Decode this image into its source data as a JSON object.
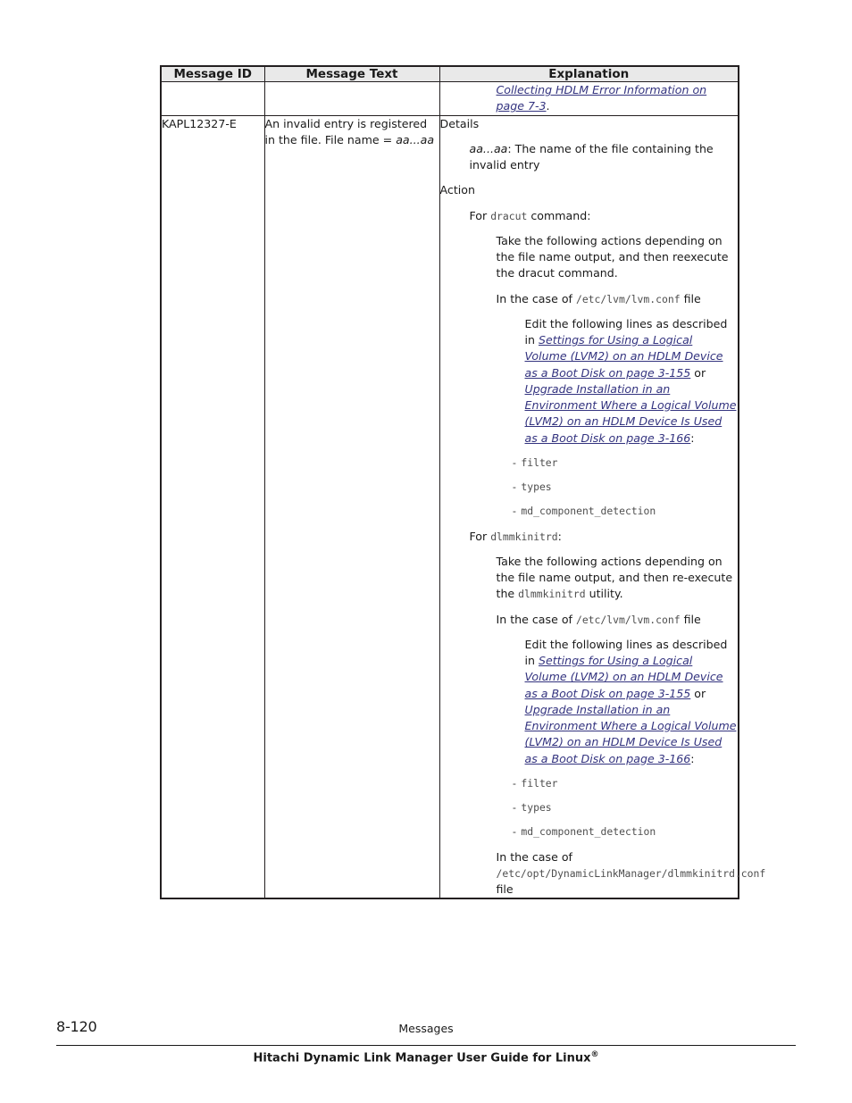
{
  "document": {
    "page_number": "8-120",
    "footer_section": "Messages",
    "footer_title_main": "Hitachi Dynamic Link Manager User Guide for Linux",
    "footer_title_sup": "®"
  },
  "table": {
    "headers": {
      "message_id": "Message ID",
      "message_text": "Message Text",
      "explanation": "Explanation"
    },
    "rows": [
      {
        "message_id": "",
        "message_text": "",
        "explanation_continued_link": "Collecting HDLM Error Information on page 7-3",
        "explanation_continued_tail": "."
      },
      {
        "message_id": "KAPL12327-E",
        "message_text_part1": "An invalid entry is registered in the file. File name = ",
        "message_text_var": "aa...aa",
        "details_label": "Details",
        "details_var": "aa...aa",
        "details_desc": ": The name of the file containing the invalid entry",
        "action_label": "Action",
        "dracut": {
          "for_prefix": "For ",
          "command": "dracut",
          "for_suffix": " command:",
          "take_actions": "Take the following actions depending on the file name output, and then reexecute the dracut command.",
          "in_case_prefix": "In the case of ",
          "in_case_path": "/etc/lvm/lvm.conf",
          "in_case_suffix": " file",
          "edit_prefix": "Edit the following lines as described in ",
          "link1": "Settings for Using a Logical Volume (LVM2) on an HDLM Device as a Boot Disk on page 3-155",
          "link_join": " or ",
          "link2": "Upgrade Installation in an Environment Where a Logical Volume (LVM2) on an HDLM Device Is Used as a Boot Disk on page 3-166",
          "link_tail": ":",
          "bullets": [
            "filter",
            "types",
            "md_component_detection"
          ]
        },
        "dlmmkinitrd": {
          "for_prefix": "For ",
          "command": "dlmmkinitrd",
          "for_suffix": ":",
          "take_actions_prefix": "Take the following actions depending on the file name output, and then re-execute the ",
          "take_actions_cmd": "dlmmkinitrd",
          "take_actions_suffix": " utility.",
          "in_case_prefix": "In the case of ",
          "in_case_path": "/etc/lvm/lvm.conf",
          "in_case_suffix": " file",
          "edit_prefix": "Edit the following lines as described in ",
          "link1": "Settings for Using a Logical Volume (LVM2) on an HDLM Device as a Boot Disk on page 3-155",
          "link_join": " or ",
          "link2": "Upgrade Installation in an Environment Where a Logical Volume (LVM2) on an HDLM Device Is Used as a Boot Disk on page 3-166",
          "link_tail": ":",
          "bullets": [
            "filter",
            "types",
            "md_component_detection"
          ],
          "in_case2_prefix": "In the case of ",
          "in_case2_path": "/etc/opt/DynamicLinkManager/dlmmkinitrd.conf",
          "in_case2_suffix": " file"
        },
        "bullet_marker": "-"
      }
    ]
  },
  "colors": {
    "link": "#33337f",
    "header_bg": "#e9e9e9",
    "border": "#231f20",
    "mono_text": "#4e4e4e"
  }
}
